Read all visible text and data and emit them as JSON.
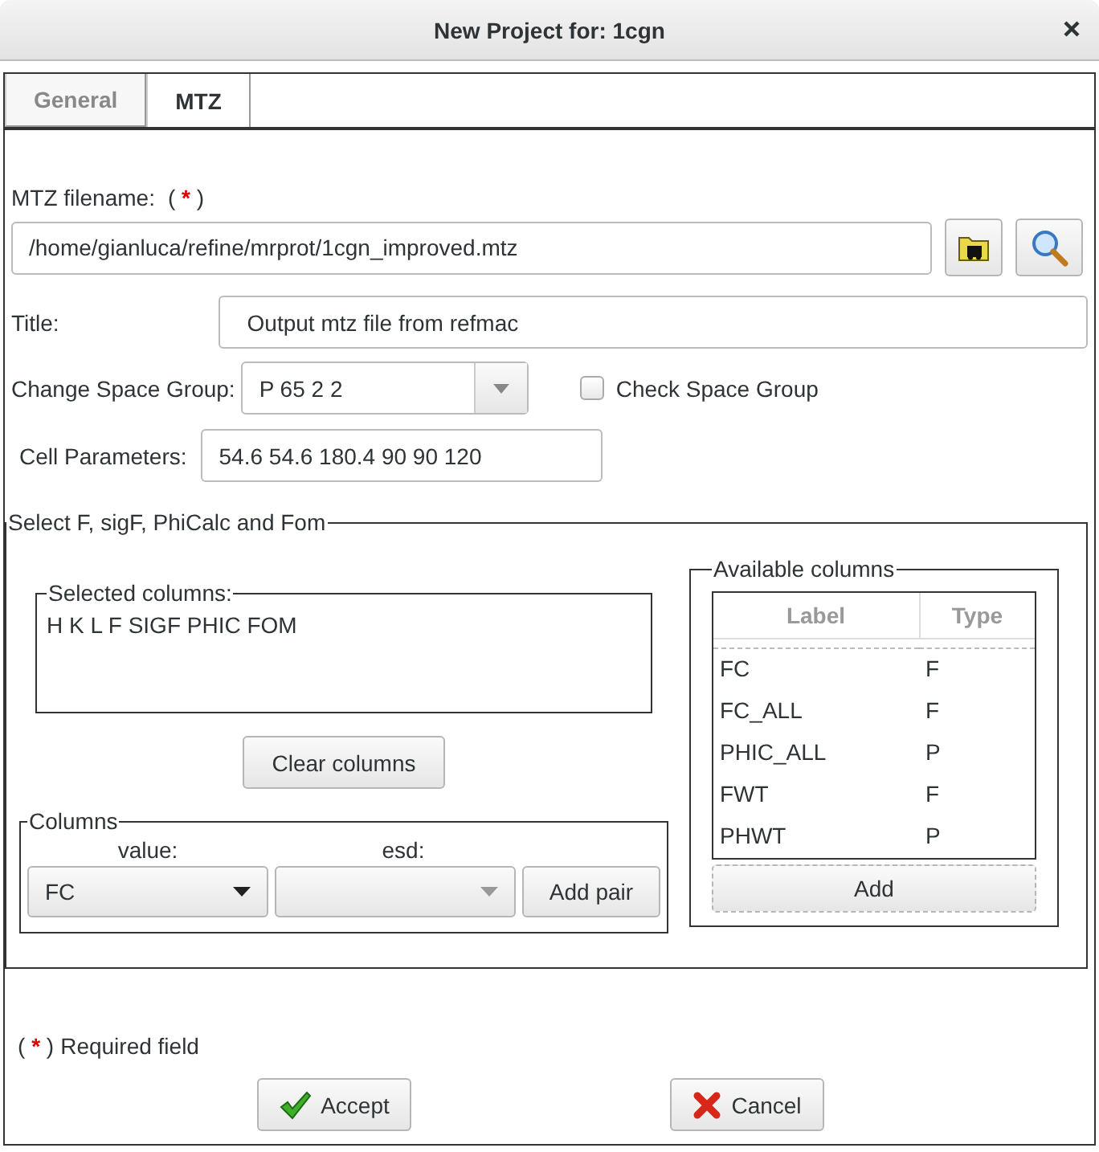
{
  "window": {
    "title": "New Project for: 1cgn"
  },
  "tabs": [
    {
      "label": "General",
      "selected": false
    },
    {
      "label": "MTZ",
      "selected": true
    }
  ],
  "mtz_filename": {
    "label": "MTZ filename:",
    "required_mark": [
      "(",
      "*",
      ")"
    ],
    "value": "/home/gianluca/refine/mrprot/1cgn_improved.mtz"
  },
  "title_field": {
    "label": "Title:",
    "value": "Output mtz file from refmac"
  },
  "space_group": {
    "label": "Change Space Group:",
    "value": "P 65 2 2"
  },
  "check_space_group": {
    "label": "Check Space Group",
    "checked": false
  },
  "cell_parameters": {
    "label": "Cell Parameters:",
    "value": "54.6 54.6 180.4 90 90 120"
  },
  "select_frame": {
    "legend": "Select F, sigF, PhiCalc and Fom",
    "selected_columns": {
      "legend": "Selected columns:",
      "text": "H K L F SIGF PHIC FOM"
    },
    "clear_button": "Clear columns",
    "columns": {
      "legend": "Columns",
      "value_label": "value:",
      "value": "FC",
      "esd_label": "esd:",
      "add_pair": "Add pair"
    },
    "available_columns": {
      "legend": "Available columns",
      "headers": [
        "Label",
        "Type"
      ],
      "rows": [
        {
          "label": "FC",
          "type": "F"
        },
        {
          "label": "FC_ALL",
          "type": "F"
        },
        {
          "label": "PHIC_ALL",
          "type": "P"
        },
        {
          "label": "FWT",
          "type": "F"
        },
        {
          "label": "PHWT",
          "type": "P"
        }
      ],
      "add_button": "Add"
    }
  },
  "required_note": {
    "mark": [
      "(",
      "*",
      ")"
    ],
    "text": "Required field"
  },
  "buttons": [
    {
      "kind": "accept",
      "label": "Accept"
    },
    {
      "kind": "cancel",
      "label": "Cancel"
    }
  ]
}
